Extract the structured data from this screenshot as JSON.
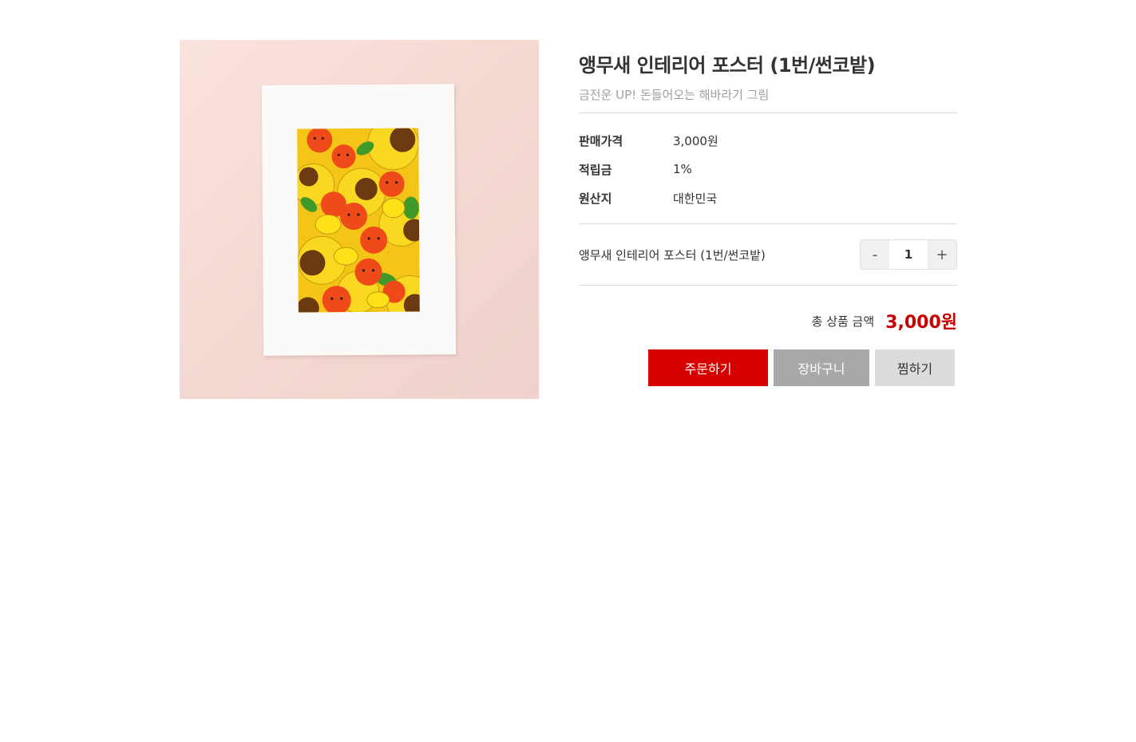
{
  "product": {
    "title": "앵무새 인테리어 포스터 (1번/썬코밭)",
    "subtitle": "금전운 UP! 돈들어오는 해바라기 그림",
    "image_alt": "parrot-sunflower-poster"
  },
  "specs": {
    "price_label": "판매가격",
    "price_value": "3,000원",
    "points_label": "적립금",
    "points_value": "1%",
    "origin_label": "원산지",
    "origin_value": "대한민국"
  },
  "option": {
    "name": "앵무새 인테리어 포스터 (1번/썬코밭)",
    "minus": "-",
    "quantity": "1",
    "plus": "+"
  },
  "total": {
    "label": "총 상품 금액",
    "value": "3,000원"
  },
  "actions": {
    "order": "주문하기",
    "cart": "장바구니",
    "wishlist": "찜하기"
  },
  "colors": {
    "accent": "#d70000",
    "price": "#c80000",
    "cart_button": "#a8a8a8",
    "wish_button": "#dcdcdc"
  }
}
